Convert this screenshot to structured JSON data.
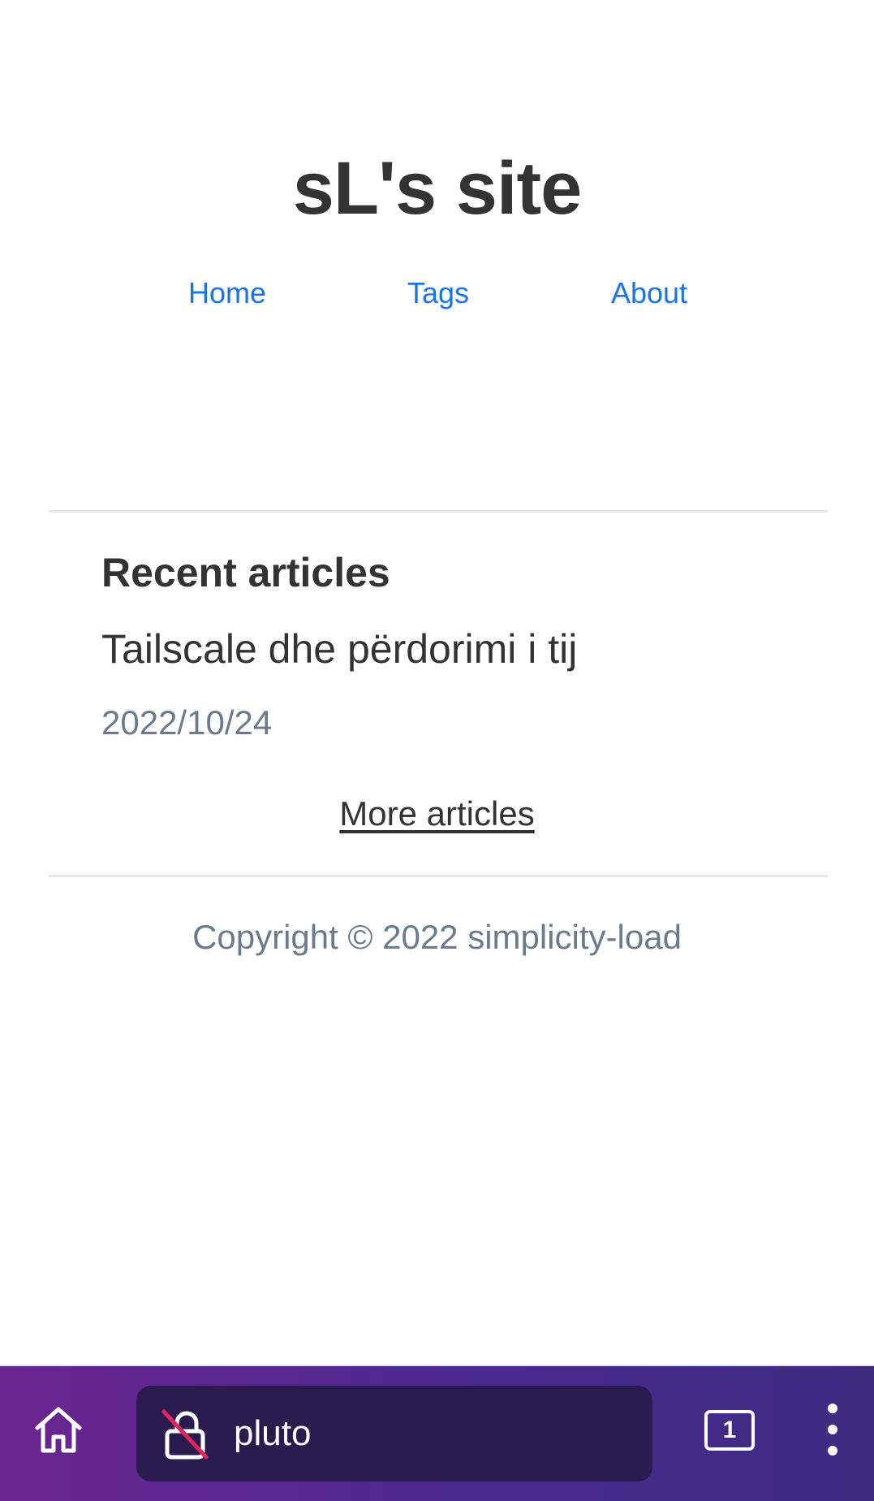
{
  "site": {
    "title": "sL's site"
  },
  "nav": {
    "items": [
      {
        "label": "Home"
      },
      {
        "label": "Tags"
      },
      {
        "label": "About"
      }
    ],
    "link_color": "#1a73e8"
  },
  "recent": {
    "heading": "Recent articles",
    "articles": [
      {
        "title": "Tailscale dhe përdorimi i tij",
        "date": "2022/10/24"
      }
    ],
    "more_label": "More articles"
  },
  "footer": {
    "copyright": "Copyright © 2022 simplicity-load"
  },
  "browser_toolbar": {
    "home_icon": "home-icon",
    "lock_icon": "insecure-lock-icon",
    "url": "pluto",
    "tab_count": "1",
    "menu_icon": "more-vertical-icon",
    "gradient_colors": [
      "#6a248f",
      "#4b2a8e",
      "#3d2b80"
    ]
  }
}
